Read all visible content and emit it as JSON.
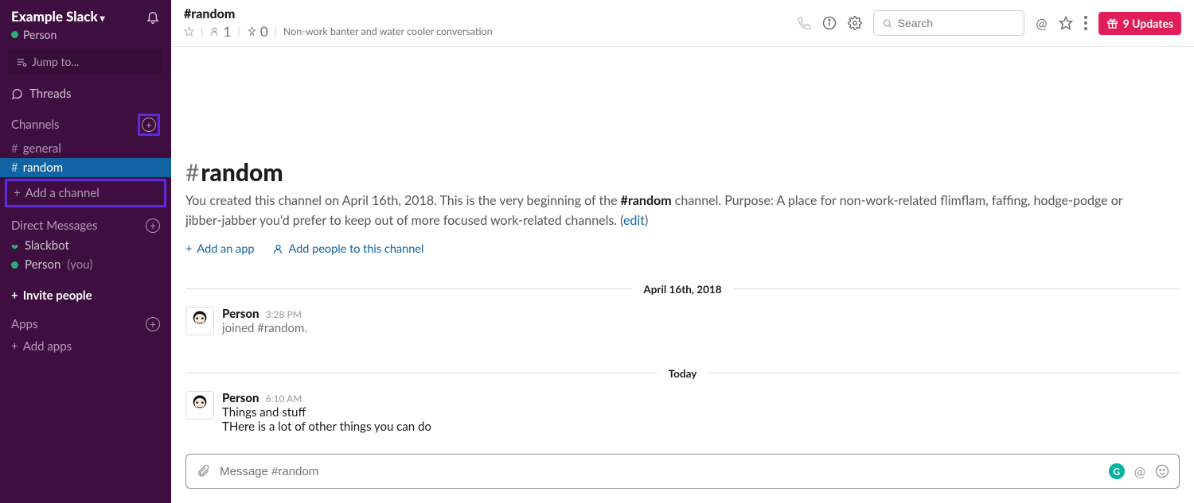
{
  "workspace": {
    "name": "Example Slack",
    "user": "Person"
  },
  "sidebar": {
    "jump_placeholder": "Jump to...",
    "threads_label": "Threads",
    "channels_header": "Channels",
    "channels": [
      {
        "name": "general",
        "active": false
      },
      {
        "name": "random",
        "active": true
      }
    ],
    "add_channel_label": "Add a channel",
    "dm_header": "Direct Messages",
    "dms": [
      {
        "name": "Slackbot",
        "presence": "heart"
      },
      {
        "name": "Person",
        "presence": "green",
        "you_label": "(you)"
      }
    ],
    "invite_label": "Invite people",
    "apps_header": "Apps",
    "add_apps_label": "Add apps"
  },
  "header": {
    "channel_name": "#random",
    "members": "1",
    "pins": "0",
    "topic": "Non-work banter and water cooler conversation",
    "search_placeholder": "Search",
    "updates_label": "9 Updates"
  },
  "intro": {
    "title_prefix": "#",
    "title": "random",
    "desc_pre": "You created this channel on April 16th, 2018. This is the very beginning of the ",
    "desc_bold": "#random",
    "desc_post": " channel. Purpose: A place for non-work-related flimflam, faffing, hodge-podge or jibber-jabber you'd prefer to keep out of more focused work-related channels. (",
    "edit_label": "edit",
    "desc_close": ")",
    "add_app_label": "Add an app",
    "add_people_label": "Add people to this channel"
  },
  "timeline": {
    "div1": "April 16th, 2018",
    "msg1": {
      "name": "Person",
      "time": "3:28 PM",
      "text": "joined #random."
    },
    "div2": "Today",
    "msg2": {
      "name": "Person",
      "time": "6:10 AM",
      "line1": "Things and stuff",
      "line2": "THere is a lot of other things you can do"
    }
  },
  "composer": {
    "placeholder": "Message #random"
  }
}
